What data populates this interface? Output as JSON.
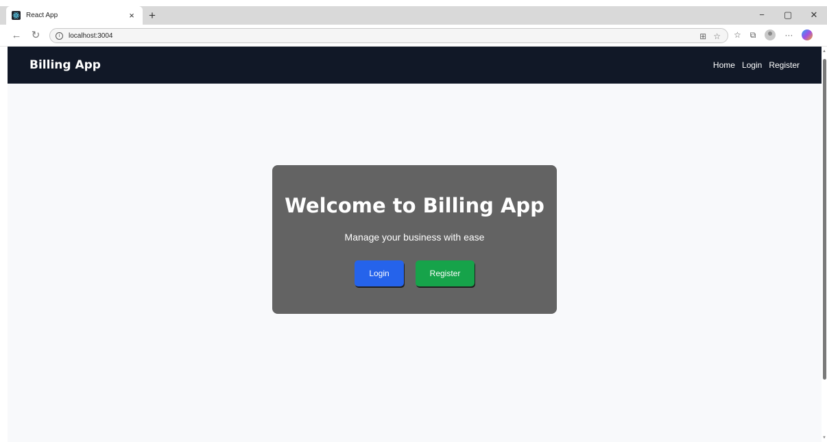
{
  "browser": {
    "tab_title": "React App",
    "tab_close": "×",
    "new_tab": "+",
    "url": "localhost:3004",
    "window_controls": {
      "minimize": "−",
      "maximize": "▢",
      "close": "✕"
    }
  },
  "navbar": {
    "brand": "Billing App",
    "links": [
      "Home",
      "Login",
      "Register"
    ]
  },
  "hero": {
    "title": "Welcome to Billing App",
    "subtitle": "Manage your business with ease",
    "login_button": "Login",
    "register_button": "Register"
  },
  "colors": {
    "navbar_bg": "#111827",
    "card_bg": "#636363",
    "login_button": "#2563eb",
    "register_button": "#16a34a",
    "page_bg": "#f8f9fb"
  }
}
